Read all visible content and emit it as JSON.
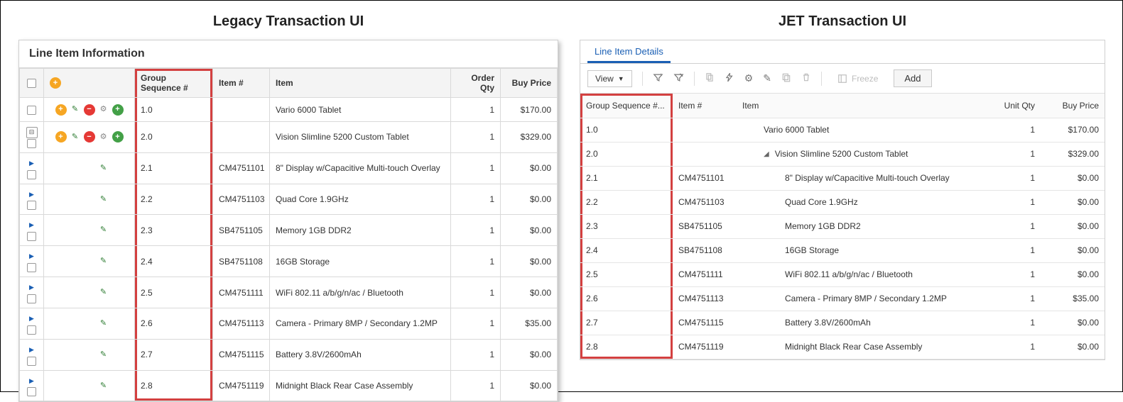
{
  "titles": {
    "left": "Legacy Transaction UI",
    "right": "JET Transaction UI"
  },
  "legacy": {
    "panel_title": "Line Item Information",
    "cols": {
      "group_seq": "Group Sequence #",
      "item_num": "Item #",
      "item": "Item",
      "qty": "Order Qty",
      "price": "Buy Price"
    },
    "rows": [
      {
        "row_type": "top",
        "collapse": "none",
        "gs": "1.0",
        "itemnum": "",
        "item": "Vario 6000 Tablet",
        "qty": "1",
        "price": "$170.00"
      },
      {
        "row_type": "top",
        "collapse": "open",
        "gs": "2.0",
        "itemnum": "",
        "item": "Vision Slimline 5200 Custom Tablet",
        "qty": "1",
        "price": "$329.00"
      },
      {
        "row_type": "child",
        "gs": "2.1",
        "itemnum": "CM4751101",
        "item": "8\" Display w/Capacitive Multi-touch Overlay",
        "qty": "1",
        "price": "$0.00"
      },
      {
        "row_type": "child",
        "gs": "2.2",
        "itemnum": "CM4751103",
        "item": "Quad Core 1.9GHz",
        "qty": "1",
        "price": "$0.00"
      },
      {
        "row_type": "child",
        "gs": "2.3",
        "itemnum": "SB4751105",
        "item": "Memory 1GB DDR2",
        "qty": "1",
        "price": "$0.00"
      },
      {
        "row_type": "child",
        "gs": "2.4",
        "itemnum": "SB4751108",
        "item": "16GB Storage",
        "qty": "1",
        "price": "$0.00"
      },
      {
        "row_type": "child",
        "gs": "2.5",
        "itemnum": "CM4751111",
        "item": "WiFi 802.11 a/b/g/n/ac / Bluetooth",
        "qty": "1",
        "price": "$0.00"
      },
      {
        "row_type": "child",
        "gs": "2.6",
        "itemnum": "CM4751113",
        "item": "Camera - Primary 8MP / Secondary 1.2MP",
        "qty": "1",
        "price": "$35.00"
      },
      {
        "row_type": "child",
        "gs": "2.7",
        "itemnum": "CM4751115",
        "item": "Battery 3.8V/2600mAh",
        "qty": "1",
        "price": "$0.00"
      },
      {
        "row_type": "child",
        "gs": "2.8",
        "itemnum": "CM4751119",
        "item": "Midnight Black Rear Case Assembly",
        "qty": "1",
        "price": "$0.00"
      }
    ]
  },
  "jet": {
    "tab_label": "Line Item Details",
    "view_label": "View",
    "freeze_label": "Freeze",
    "add_label": "Add",
    "cols": {
      "group_seq": "Group Sequence #...",
      "item_num": "Item #",
      "item": "Item",
      "qty": "Unit Qty",
      "price": "Buy Price"
    },
    "rows": [
      {
        "indent": 1,
        "expand": "",
        "gs": "1.0",
        "itemnum": "",
        "item": "Vario 6000 Tablet",
        "qty": "1",
        "price": "$170.00"
      },
      {
        "indent": 1,
        "expand": "open",
        "gs": "2.0",
        "itemnum": "",
        "item": "Vision Slimline 5200 Custom Tablet",
        "qty": "1",
        "price": "$329.00"
      },
      {
        "indent": 2,
        "expand": "",
        "gs": "2.1",
        "itemnum": "CM4751101",
        "item": "8\" Display w/Capacitive Multi-touch Overlay",
        "qty": "1",
        "price": "$0.00"
      },
      {
        "indent": 2,
        "expand": "",
        "gs": "2.2",
        "itemnum": "CM4751103",
        "item": "Quad Core 1.9GHz",
        "qty": "1",
        "price": "$0.00"
      },
      {
        "indent": 2,
        "expand": "",
        "gs": "2.3",
        "itemnum": "SB4751105",
        "item": "Memory 1GB DDR2",
        "qty": "1",
        "price": "$0.00"
      },
      {
        "indent": 2,
        "expand": "",
        "gs": "2.4",
        "itemnum": "SB4751108",
        "item": "16GB Storage",
        "qty": "1",
        "price": "$0.00"
      },
      {
        "indent": 2,
        "expand": "",
        "gs": "2.5",
        "itemnum": "CM4751111",
        "item": "WiFi 802.11 a/b/g/n/ac / Bluetooth",
        "qty": "1",
        "price": "$0.00"
      },
      {
        "indent": 2,
        "expand": "",
        "gs": "2.6",
        "itemnum": "CM4751113",
        "item": "Camera - Primary 8MP / Secondary 1.2MP",
        "qty": "1",
        "price": "$35.00"
      },
      {
        "indent": 2,
        "expand": "",
        "gs": "2.7",
        "itemnum": "CM4751115",
        "item": "Battery 3.8V/2600mAh",
        "qty": "1",
        "price": "$0.00"
      },
      {
        "indent": 2,
        "expand": "",
        "gs": "2.8",
        "itemnum": "CM4751119",
        "item": "Midnight Black Rear Case Assembly",
        "qty": "1",
        "price": "$0.00"
      }
    ]
  }
}
